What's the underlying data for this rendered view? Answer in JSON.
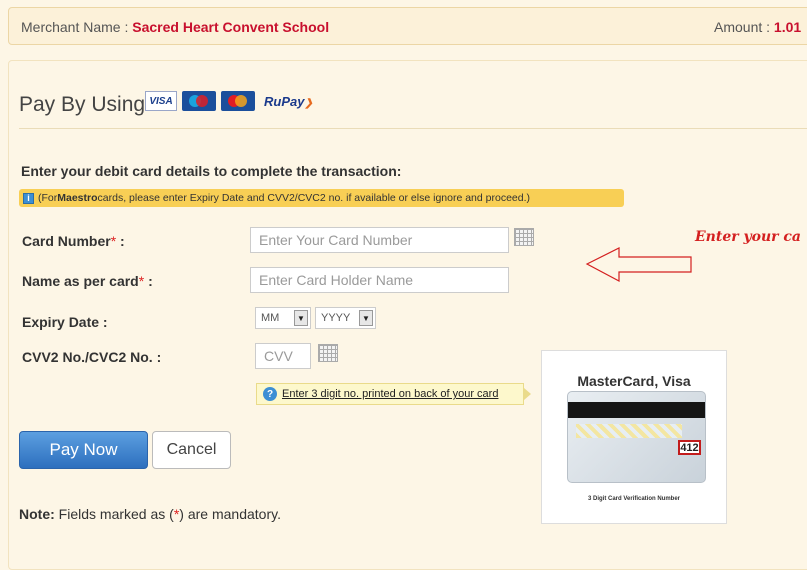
{
  "merchant": {
    "label": "Merchant Name : ",
    "name": "Sacred Heart Convent School",
    "amount_label": "Amount : ",
    "amount_value": "1.01"
  },
  "payment": {
    "pay_by_label": "Pay By Using",
    "logos": [
      "VISA",
      "Maestro",
      "MasterCard",
      "RuPay"
    ]
  },
  "form": {
    "instructions": "Enter your debit card details to complete the transaction:",
    "maestro_note_prefix": "(For ",
    "maestro_note_brand": "Maestro",
    "maestro_note_suffix": " cards, please enter Expiry Date and CVV2/CVC2 no. if available or else ignore and proceed.)",
    "card_number_label": "Card Number",
    "card_number_placeholder": "Enter Your Card Number",
    "name_label": "Name as per card",
    "name_placeholder": "Enter Card Holder Name",
    "expiry_label": "Expiry Date :",
    "expiry_month": "MM",
    "expiry_year": "YYYY",
    "cvv_label": "CVV2 No./CVC2 No. :",
    "cvv_placeholder": "CVV",
    "cvv_hint": "Enter 3 digit no. printed on back of your card",
    "required_mark": "*",
    "label_colon": " :"
  },
  "buttons": {
    "pay_now": "Pay Now",
    "cancel": "Cancel"
  },
  "note": {
    "prefix": "Note:",
    "text_before": " Fields marked as (",
    "asterisk": "*",
    "text_after": ") are mandatory."
  },
  "card_example": {
    "title": "MasterCard, Visa",
    "cvv_digits": "412",
    "caption": "3 Digit Card Verification Number"
  },
  "annotation": {
    "text": "Enter your ca"
  },
  "colors": {
    "accent_red": "#c8102e",
    "pay_button": "#2d6fbe",
    "note_bar": "#f8cf55"
  }
}
